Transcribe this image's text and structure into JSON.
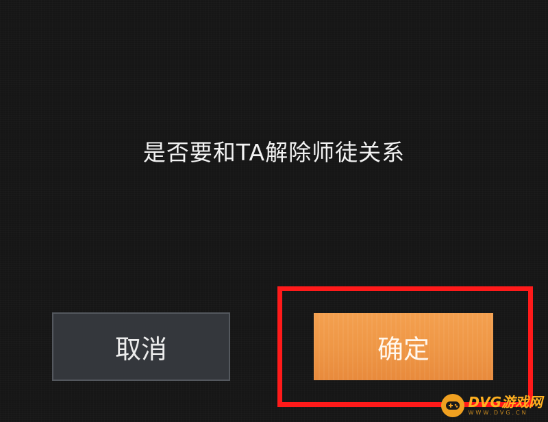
{
  "dialog": {
    "prompt": "是否要和TA解除师徒关系",
    "cancel_label": "取消",
    "confirm_label": "确定"
  },
  "watermark": {
    "brand": "DVG游戏网",
    "url": "WWW.DVG.CN",
    "icon": "gamepad-icon"
  },
  "colors": {
    "background": "#161616",
    "cancel_button": "#34373c",
    "confirm_button": "#ee9645",
    "highlight": "#ff1a1a"
  }
}
